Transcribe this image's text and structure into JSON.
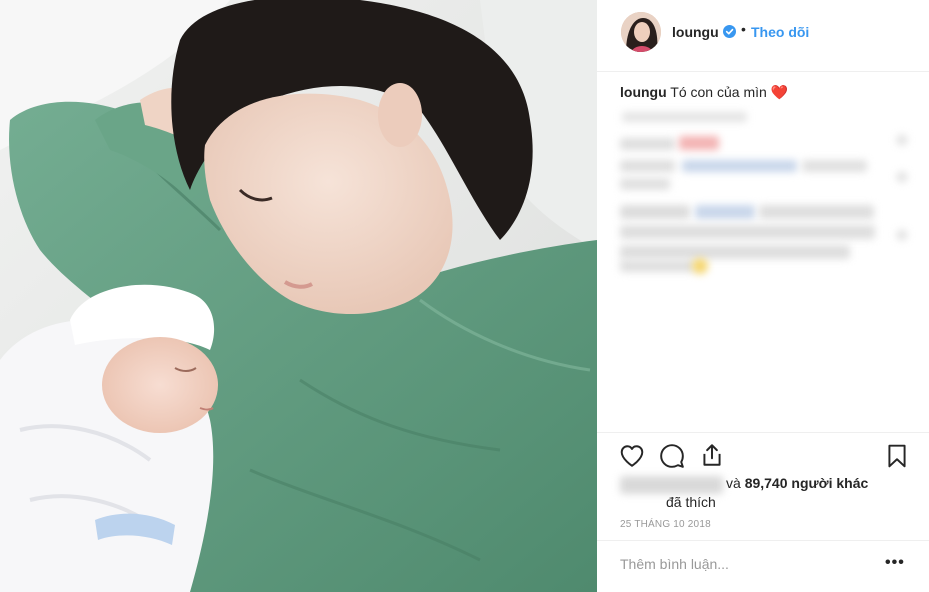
{
  "post": {
    "username": "loungu",
    "follow_label": "Theo dõi",
    "header_separator": "•",
    "caption_text": "Tó con của mìn",
    "caption_emoji": "❤️",
    "likes_prefix": "và",
    "likes_count": "89,740",
    "likes_suffix": "người khác",
    "liked_label": "đã thích",
    "date": "25 THÁNG 10 2018",
    "more_label": "•••"
  },
  "comment": {
    "placeholder": "Thêm bình luận..."
  },
  "icons": {
    "verified": "verified-badge-icon",
    "like": "heart-icon",
    "comment": "comment-bubble-icon",
    "share": "share-icon",
    "save": "bookmark-icon"
  },
  "colors": {
    "follow": "#3897f0",
    "verified": "#3897f0",
    "text": "#262626",
    "muted": "#999999",
    "border": "#efefef",
    "gown": "#5f9a7e"
  }
}
